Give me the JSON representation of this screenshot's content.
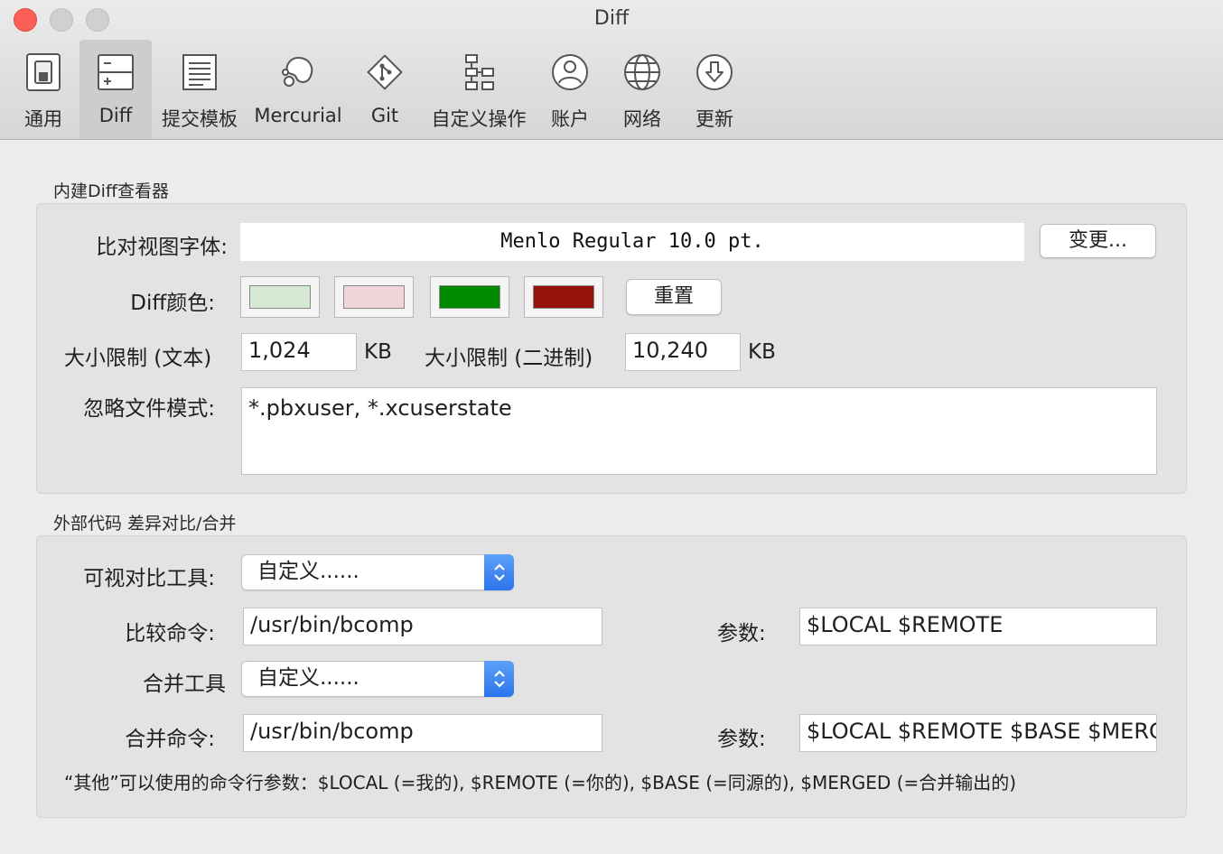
{
  "window": {
    "title": "Diff"
  },
  "toolbar": {
    "items": [
      {
        "label": "通用",
        "icon": "switch-icon"
      },
      {
        "label": "Diff",
        "icon": "diff-icon",
        "selected": true
      },
      {
        "label": "提交模板",
        "icon": "template-icon"
      },
      {
        "label": "Mercurial",
        "icon": "mercurial-icon"
      },
      {
        "label": "Git",
        "icon": "git-icon"
      },
      {
        "label": "自定义操作",
        "icon": "custom-actions-icon"
      },
      {
        "label": "账户",
        "icon": "account-icon"
      },
      {
        "label": "网络",
        "icon": "globe-icon"
      },
      {
        "label": "更新",
        "icon": "download-icon"
      }
    ]
  },
  "builtin": {
    "title": "内建Diff查看器",
    "font_label": "比对视图字体:",
    "font_value": "Menlo Regular 10.0 pt.",
    "change_button": "变更...",
    "color_label": "Diff颜色:",
    "colors": [
      "#d5ead2",
      "#f0d4d8",
      "#008a00",
      "#951208"
    ],
    "reset_button": "重置",
    "size_text_label": "大小限制 (文本)",
    "size_text_value": "1,024",
    "size_text_unit": "KB",
    "size_binary_label": "大小限制 (二进制)",
    "size_binary_value": "10,240",
    "size_binary_unit": "KB",
    "ignore_label": "忽略文件模式:",
    "ignore_value": "*.pbxuser, *.xcuserstate"
  },
  "external": {
    "title": "外部代码 差异对比/合并",
    "visual_tool_label": "可视对比工具:",
    "visual_tool_value": "自定义......",
    "diff_cmd_label": "比较命令:",
    "diff_cmd_value": "/usr/bin/bcomp",
    "diff_args_label": "参数:",
    "diff_args_value": "$LOCAL $REMOTE",
    "merge_tool_label": "合并工具",
    "merge_tool_value": "自定义......",
    "merge_cmd_label": "合并命令:",
    "merge_cmd_value": "/usr/bin/bcomp",
    "merge_args_label": "参数:",
    "merge_args_value": "$LOCAL $REMOTE $BASE $MERGED",
    "note": "“其他”可以使用的命令行参数：$LOCAL (=我的), $REMOTE (=你的), $BASE (=同源的), $MERGED (=合并输出的)"
  }
}
